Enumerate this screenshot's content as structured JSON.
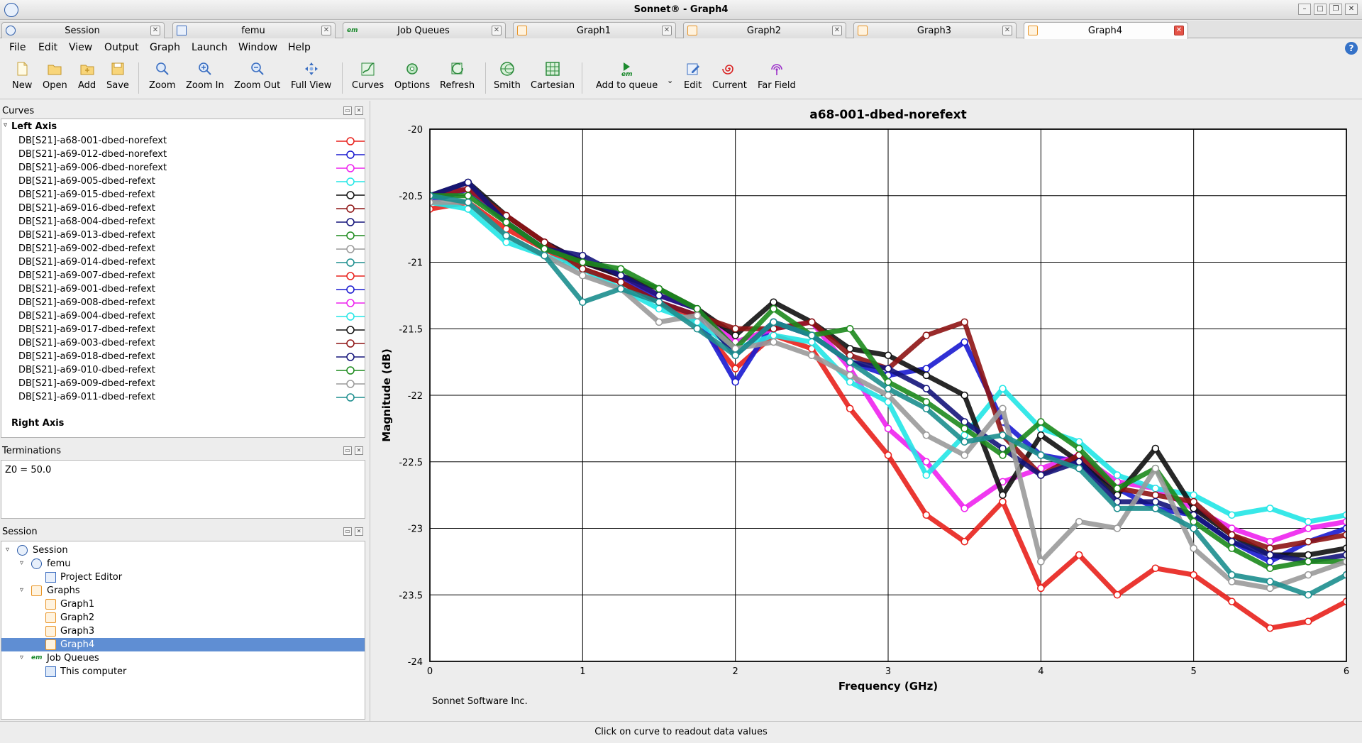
{
  "window": {
    "title": "Sonnet® - Graph4"
  },
  "tabs": [
    {
      "label": "Session",
      "icon": "session-icon"
    },
    {
      "label": "femu",
      "icon": "project-editor-icon"
    },
    {
      "label": "Job Queues",
      "icon": "em-icon"
    },
    {
      "label": "Graph1",
      "icon": "graph-icon"
    },
    {
      "label": "Graph2",
      "icon": "graph-icon"
    },
    {
      "label": "Graph3",
      "icon": "graph-icon"
    },
    {
      "label": "Graph4",
      "icon": "graph-icon",
      "active": true
    }
  ],
  "menu": [
    "File",
    "Edit",
    "View",
    "Output",
    "Graph",
    "Launch",
    "Window",
    "Help"
  ],
  "toolbar": [
    {
      "label": "New",
      "icon": "new-file-icon"
    },
    {
      "label": "Open",
      "icon": "open-folder-icon"
    },
    {
      "label": "Add",
      "icon": "add-folder-icon"
    },
    {
      "label": "Save",
      "icon": "save-disk-icon"
    },
    {
      "label": "Zoom",
      "icon": "zoom-icon"
    },
    {
      "label": "Zoom In",
      "icon": "zoom-in-icon"
    },
    {
      "label": "Zoom Out",
      "icon": "zoom-out-icon"
    },
    {
      "label": "Full View",
      "icon": "full-view-icon"
    },
    {
      "label": "Curves",
      "icon": "curves-icon"
    },
    {
      "label": "Options",
      "icon": "options-icon"
    },
    {
      "label": "Refresh",
      "icon": "refresh-icon"
    },
    {
      "label": "Smith",
      "icon": "smith-chart-icon"
    },
    {
      "label": "Cartesian",
      "icon": "cartesian-grid-icon"
    },
    {
      "label": "Add to queue",
      "icon": "em-add-to-queue-icon"
    },
    {
      "label": "Edit",
      "icon": "edit-icon"
    },
    {
      "label": "Current",
      "icon": "current-icon"
    },
    {
      "label": "Far Field",
      "icon": "far-field-icon"
    }
  ],
  "curves_panel": {
    "title": "Curves",
    "left_axis_label": "Left Axis",
    "right_axis_label": "Right Axis",
    "curves": [
      {
        "name": "DB[S21]-a68-001-dbed-norefext",
        "color": "#e8211c"
      },
      {
        "name": "DB[S21]-a69-012-dbed-norefext",
        "color": "#1a1ad0"
      },
      {
        "name": "DB[S21]-a69-006-dbed-norefext",
        "color": "#ee22ee"
      },
      {
        "name": "DB[S21]-a69-005-dbed-refext",
        "color": "#22e6e6"
      },
      {
        "name": "DB[S21]-a69-015-dbed-refext",
        "color": "#111111"
      },
      {
        "name": "DB[S21]-a69-016-dbed-refext",
        "color": "#8e1414"
      },
      {
        "name": "DB[S21]-a68-004-dbed-refext",
        "color": "#14147a"
      },
      {
        "name": "DB[S21]-a69-013-dbed-refext",
        "color": "#1c8a1c"
      },
      {
        "name": "DB[S21]-a69-002-dbed-refext",
        "color": "#9a9a9a"
      },
      {
        "name": "DB[S21]-a69-014-dbed-refext",
        "color": "#1c8e8e"
      },
      {
        "name": "DB[S21]-a69-007-dbed-refext",
        "color": "#e8211c"
      },
      {
        "name": "DB[S21]-a69-001-dbed-refext",
        "color": "#1a1ad0"
      },
      {
        "name": "DB[S21]-a69-008-dbed-refext",
        "color": "#ee22ee"
      },
      {
        "name": "DB[S21]-a69-004-dbed-refext",
        "color": "#22e6e6"
      },
      {
        "name": "DB[S21]-a69-017-dbed-refext",
        "color": "#111111"
      },
      {
        "name": "DB[S21]-a69-003-dbed-refext",
        "color": "#8e1414"
      },
      {
        "name": "DB[S21]-a69-018-dbed-refext",
        "color": "#14147a"
      },
      {
        "name": "DB[S21]-a69-010-dbed-refext",
        "color": "#1c8a1c"
      },
      {
        "name": "DB[S21]-a69-009-dbed-refext",
        "color": "#9a9a9a"
      },
      {
        "name": "DB[S21]-a69-011-dbed-refext",
        "color": "#1c8e8e"
      }
    ]
  },
  "terminations_panel": {
    "title": "Terminations",
    "text": "Z0 = 50.0"
  },
  "session_panel": {
    "title": "Session",
    "tree": [
      {
        "label": "Session",
        "icon": "session-icon",
        "expanded": true
      },
      {
        "label": "femu",
        "icon": "session-icon",
        "expanded": true
      },
      {
        "label": "Project Editor",
        "icon": "project-editor-icon"
      },
      {
        "label": "Graphs",
        "icon": "graph-folder-icon",
        "expanded": true
      },
      {
        "label": "Graph1",
        "icon": "graph-icon"
      },
      {
        "label": "Graph2",
        "icon": "graph-icon"
      },
      {
        "label": "Graph3",
        "icon": "graph-icon"
      },
      {
        "label": "Graph4",
        "icon": "graph-icon",
        "selected": true
      },
      {
        "label": "Job Queues",
        "icon": "em-icon",
        "expanded": true
      },
      {
        "label": "This computer",
        "icon": "computer-icon"
      }
    ]
  },
  "graph": {
    "footer": "Sonnet Software Inc."
  },
  "chart_data": {
    "type": "line",
    "title": "a68-001-dbed-norefext",
    "xlabel": "Frequency (GHz)",
    "ylabel": "Magnitude (dB)",
    "xlim": [
      0,
      6
    ],
    "ylim": [
      -24,
      -20
    ],
    "xticks": [
      "0",
      "1",
      "2",
      "3",
      "4",
      "5",
      "6"
    ],
    "yticks": [
      "-20",
      "-20.5",
      "-21",
      "-21.5",
      "-22",
      "-22.5",
      "-23",
      "-23.5",
      "-24"
    ],
    "grid": true,
    "x": [
      0,
      0.25,
      0.5,
      0.75,
      1,
      1.25,
      1.5,
      1.75,
      2,
      2.25,
      2.5,
      2.75,
      3,
      3.25,
      3.5,
      3.75,
      4,
      4.25,
      4.5,
      4.75,
      5,
      5.25,
      5.5,
      5.75,
      6
    ],
    "series": [
      {
        "name": "DB[S21]-a68-001-dbed-norefext",
        "values": [
          -20.6,
          -20.55,
          -20.75,
          -20.9,
          -21.05,
          -21.15,
          -21.3,
          -21.45,
          -21.8,
          -21.55,
          -21.65,
          -22.1,
          -22.45,
          -22.9,
          -23.1,
          -22.8,
          -23.45,
          -23.2,
          -23.5,
          -23.3,
          -23.35,
          -23.55,
          -23.75,
          -23.7,
          -23.55
        ]
      },
      {
        "name": "DB[S21]-a69-012-dbed-norefext",
        "values": [
          -20.55,
          -20.45,
          -20.7,
          -20.9,
          -21.0,
          -21.1,
          -21.3,
          -21.4,
          -21.9,
          -21.45,
          -21.55,
          -21.75,
          -21.85,
          -21.8,
          -21.6,
          -22.2,
          -22.45,
          -22.5,
          -22.7,
          -22.85,
          -22.9,
          -23.1,
          -23.25,
          -23.1,
          -23.0
        ]
      },
      {
        "name": "DB[S21]-a69-006-dbed-norefext",
        "values": [
          -20.5,
          -20.45,
          -20.65,
          -20.85,
          -21.0,
          -21.1,
          -21.25,
          -21.35,
          -21.6,
          -21.5,
          -21.45,
          -21.8,
          -22.25,
          -22.5,
          -22.85,
          -22.65,
          -22.55,
          -22.45,
          -22.65,
          -22.7,
          -22.85,
          -23.0,
          -23.1,
          -23.0,
          -22.95
        ]
      },
      {
        "name": "DB[S21]-a69-005-dbed-refext",
        "values": [
          -20.55,
          -20.6,
          -20.85,
          -20.95,
          -21.05,
          -21.2,
          -21.35,
          -21.45,
          -21.65,
          -21.55,
          -21.6,
          -21.9,
          -22.05,
          -22.6,
          -22.3,
          -21.95,
          -22.25,
          -22.35,
          -22.6,
          -22.7,
          -22.75,
          -22.9,
          -22.85,
          -22.95,
          -22.9
        ]
      },
      {
        "name": "DB[S21]-a69-015-dbed-refext",
        "values": [
          -20.5,
          -20.4,
          -20.65,
          -20.85,
          -21.0,
          -21.1,
          -21.2,
          -21.35,
          -21.55,
          -21.3,
          -21.45,
          -21.65,
          -21.7,
          -21.85,
          -22.0,
          -22.75,
          -22.3,
          -22.5,
          -22.75,
          -22.4,
          -22.85,
          -23.05,
          -23.2,
          -23.2,
          -23.15
        ]
      },
      {
        "name": "DB[S21]-a69-016-dbed-refext",
        "values": [
          -20.5,
          -20.45,
          -20.65,
          -20.85,
          -21.05,
          -21.15,
          -21.3,
          -21.4,
          -21.5,
          -21.5,
          -21.45,
          -21.7,
          -21.8,
          -21.55,
          -21.45,
          -22.3,
          -22.6,
          -22.45,
          -22.7,
          -22.75,
          -22.8,
          -23.05,
          -23.15,
          -23.1,
          -23.05
        ]
      },
      {
        "name": "DB[S21]-a68-004-dbed-refext",
        "values": [
          -20.5,
          -20.4,
          -20.7,
          -20.9,
          -20.95,
          -21.1,
          -21.25,
          -21.35,
          -21.7,
          -21.45,
          -21.55,
          -21.75,
          -21.8,
          -21.95,
          -22.2,
          -22.4,
          -22.6,
          -22.5,
          -22.8,
          -22.8,
          -22.9,
          -23.1,
          -23.2,
          -23.25,
          -23.2
        ]
      },
      {
        "name": "DB[S21]-a69-013-dbed-refext",
        "values": [
          -20.5,
          -20.5,
          -20.7,
          -20.9,
          -21.0,
          -21.05,
          -21.2,
          -21.35,
          -21.65,
          -21.35,
          -21.55,
          -21.5,
          -21.9,
          -22.05,
          -22.25,
          -22.45,
          -22.2,
          -22.4,
          -22.7,
          -22.55,
          -22.95,
          -23.15,
          -23.3,
          -23.25,
          -23.25
        ]
      },
      {
        "name": "DB[S21]-a69-002-dbed-refext",
        "values": [
          -20.55,
          -20.55,
          -20.8,
          -20.95,
          -21.1,
          -21.2,
          -21.45,
          -21.4,
          -21.65,
          -21.6,
          -21.7,
          -21.85,
          -22.0,
          -22.3,
          -22.45,
          -22.1,
          -23.25,
          -22.95,
          -23.0,
          -22.55,
          -23.15,
          -23.4,
          -23.45,
          -23.35,
          -23.25
        ]
      },
      {
        "name": "DB[S21]-a69-014-dbed-refext",
        "values": [
          -20.5,
          -20.55,
          -20.8,
          -20.95,
          -21.3,
          -21.2,
          -21.3,
          -21.5,
          -21.7,
          -21.45,
          -21.55,
          -21.75,
          -21.95,
          -22.1,
          -22.35,
          -22.3,
          -22.45,
          -22.55,
          -22.85,
          -22.85,
          -23.0,
          -23.35,
          -23.4,
          -23.5,
          -23.35
        ]
      }
    ]
  },
  "status": {
    "text": "Click on curve to readout data values"
  }
}
